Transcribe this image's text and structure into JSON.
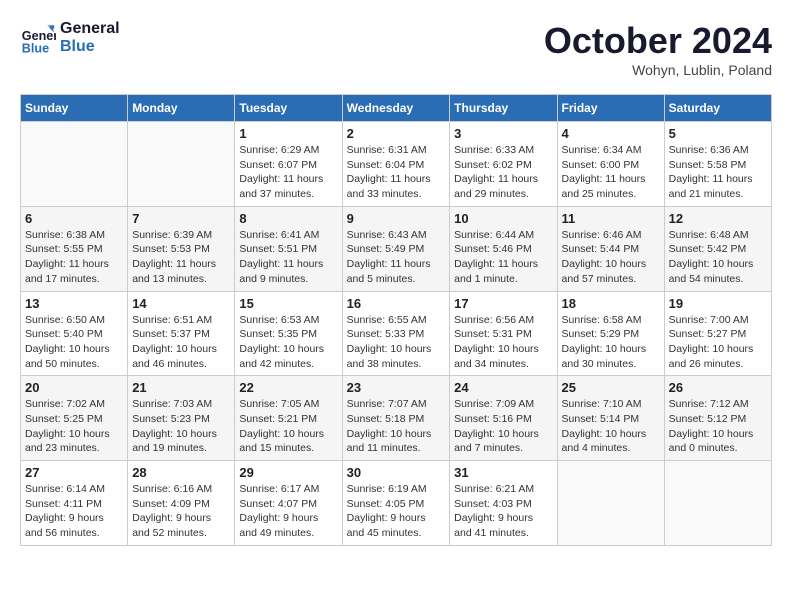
{
  "header": {
    "logo_line1": "General",
    "logo_line2": "Blue",
    "month": "October 2024",
    "location": "Wohyn, Lublin, Poland"
  },
  "days_of_week": [
    "Sunday",
    "Monday",
    "Tuesday",
    "Wednesday",
    "Thursday",
    "Friday",
    "Saturday"
  ],
  "weeks": [
    [
      {
        "day": "",
        "detail": ""
      },
      {
        "day": "",
        "detail": ""
      },
      {
        "day": "1",
        "detail": "Sunrise: 6:29 AM\nSunset: 6:07 PM\nDaylight: 11 hours and 37 minutes."
      },
      {
        "day": "2",
        "detail": "Sunrise: 6:31 AM\nSunset: 6:04 PM\nDaylight: 11 hours and 33 minutes."
      },
      {
        "day": "3",
        "detail": "Sunrise: 6:33 AM\nSunset: 6:02 PM\nDaylight: 11 hours and 29 minutes."
      },
      {
        "day": "4",
        "detail": "Sunrise: 6:34 AM\nSunset: 6:00 PM\nDaylight: 11 hours and 25 minutes."
      },
      {
        "day": "5",
        "detail": "Sunrise: 6:36 AM\nSunset: 5:58 PM\nDaylight: 11 hours and 21 minutes."
      }
    ],
    [
      {
        "day": "6",
        "detail": "Sunrise: 6:38 AM\nSunset: 5:55 PM\nDaylight: 11 hours and 17 minutes."
      },
      {
        "day": "7",
        "detail": "Sunrise: 6:39 AM\nSunset: 5:53 PM\nDaylight: 11 hours and 13 minutes."
      },
      {
        "day": "8",
        "detail": "Sunrise: 6:41 AM\nSunset: 5:51 PM\nDaylight: 11 hours and 9 minutes."
      },
      {
        "day": "9",
        "detail": "Sunrise: 6:43 AM\nSunset: 5:49 PM\nDaylight: 11 hours and 5 minutes."
      },
      {
        "day": "10",
        "detail": "Sunrise: 6:44 AM\nSunset: 5:46 PM\nDaylight: 11 hours and 1 minute."
      },
      {
        "day": "11",
        "detail": "Sunrise: 6:46 AM\nSunset: 5:44 PM\nDaylight: 10 hours and 57 minutes."
      },
      {
        "day": "12",
        "detail": "Sunrise: 6:48 AM\nSunset: 5:42 PM\nDaylight: 10 hours and 54 minutes."
      }
    ],
    [
      {
        "day": "13",
        "detail": "Sunrise: 6:50 AM\nSunset: 5:40 PM\nDaylight: 10 hours and 50 minutes."
      },
      {
        "day": "14",
        "detail": "Sunrise: 6:51 AM\nSunset: 5:37 PM\nDaylight: 10 hours and 46 minutes."
      },
      {
        "day": "15",
        "detail": "Sunrise: 6:53 AM\nSunset: 5:35 PM\nDaylight: 10 hours and 42 minutes."
      },
      {
        "day": "16",
        "detail": "Sunrise: 6:55 AM\nSunset: 5:33 PM\nDaylight: 10 hours and 38 minutes."
      },
      {
        "day": "17",
        "detail": "Sunrise: 6:56 AM\nSunset: 5:31 PM\nDaylight: 10 hours and 34 minutes."
      },
      {
        "day": "18",
        "detail": "Sunrise: 6:58 AM\nSunset: 5:29 PM\nDaylight: 10 hours and 30 minutes."
      },
      {
        "day": "19",
        "detail": "Sunrise: 7:00 AM\nSunset: 5:27 PM\nDaylight: 10 hours and 26 minutes."
      }
    ],
    [
      {
        "day": "20",
        "detail": "Sunrise: 7:02 AM\nSunset: 5:25 PM\nDaylight: 10 hours and 23 minutes."
      },
      {
        "day": "21",
        "detail": "Sunrise: 7:03 AM\nSunset: 5:23 PM\nDaylight: 10 hours and 19 minutes."
      },
      {
        "day": "22",
        "detail": "Sunrise: 7:05 AM\nSunset: 5:21 PM\nDaylight: 10 hours and 15 minutes."
      },
      {
        "day": "23",
        "detail": "Sunrise: 7:07 AM\nSunset: 5:18 PM\nDaylight: 10 hours and 11 minutes."
      },
      {
        "day": "24",
        "detail": "Sunrise: 7:09 AM\nSunset: 5:16 PM\nDaylight: 10 hours and 7 minutes."
      },
      {
        "day": "25",
        "detail": "Sunrise: 7:10 AM\nSunset: 5:14 PM\nDaylight: 10 hours and 4 minutes."
      },
      {
        "day": "26",
        "detail": "Sunrise: 7:12 AM\nSunset: 5:12 PM\nDaylight: 10 hours and 0 minutes."
      }
    ],
    [
      {
        "day": "27",
        "detail": "Sunrise: 6:14 AM\nSunset: 4:11 PM\nDaylight: 9 hours and 56 minutes."
      },
      {
        "day": "28",
        "detail": "Sunrise: 6:16 AM\nSunset: 4:09 PM\nDaylight: 9 hours and 52 minutes."
      },
      {
        "day": "29",
        "detail": "Sunrise: 6:17 AM\nSunset: 4:07 PM\nDaylight: 9 hours and 49 minutes."
      },
      {
        "day": "30",
        "detail": "Sunrise: 6:19 AM\nSunset: 4:05 PM\nDaylight: 9 hours and 45 minutes."
      },
      {
        "day": "31",
        "detail": "Sunrise: 6:21 AM\nSunset: 4:03 PM\nDaylight: 9 hours and 41 minutes."
      },
      {
        "day": "",
        "detail": ""
      },
      {
        "day": "",
        "detail": ""
      }
    ]
  ]
}
